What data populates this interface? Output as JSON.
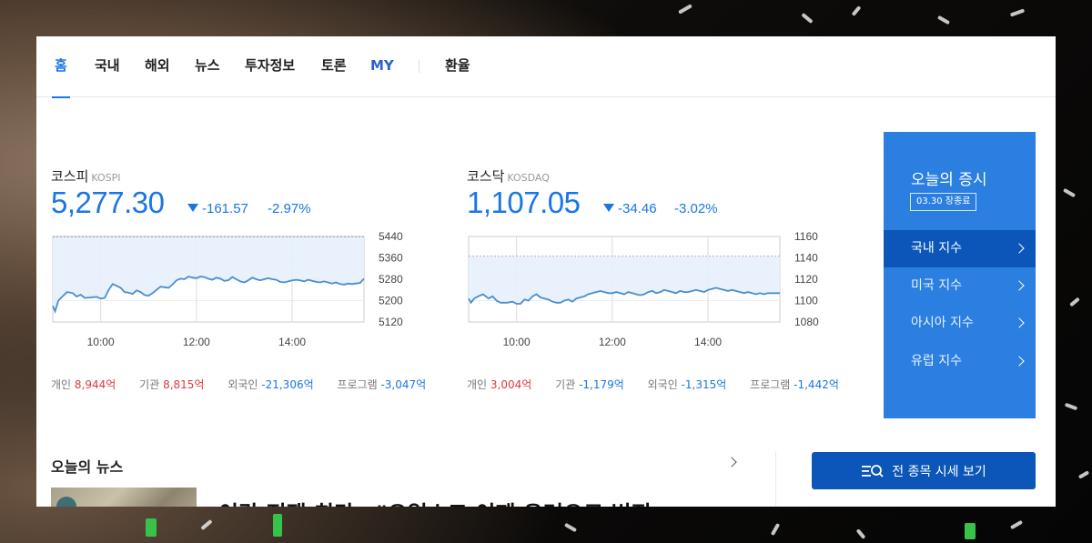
{
  "nav": {
    "items": [
      {
        "label": "홈",
        "active": true
      },
      {
        "label": "국내"
      },
      {
        "label": "해외"
      },
      {
        "label": "뉴스"
      },
      {
        "label": "투자정보"
      },
      {
        "label": "토론"
      },
      {
        "label": "MY"
      },
      {
        "label": "환율"
      }
    ]
  },
  "kospi": {
    "name": "코스피",
    "code": "KOSPI",
    "value": "5,277.30",
    "change": "-161.57",
    "percent": "-2.97%",
    "flows": [
      {
        "label": "개인",
        "value": "8,944억",
        "dir": "up"
      },
      {
        "label": "기관",
        "value": "8,815억",
        "dir": "up"
      },
      {
        "label": "외국인",
        "value": "-21,306억",
        "dir": "down"
      },
      {
        "label": "프로그램",
        "value": "-3,047억",
        "dir": "down"
      }
    ]
  },
  "kosdaq": {
    "name": "코스닥",
    "code": "KOSDAQ",
    "value": "1,107.05",
    "change": "-34.46",
    "percent": "-3.02%",
    "flows": [
      {
        "label": "개인",
        "value": "3,004억",
        "dir": "up"
      },
      {
        "label": "기관",
        "value": "-1,179억",
        "dir": "down"
      },
      {
        "label": "외국인",
        "value": "-1,315억",
        "dir": "down"
      },
      {
        "label": "프로그램",
        "value": "-1,442억",
        "dir": "down"
      }
    ]
  },
  "chart_data": [
    {
      "type": "area",
      "x_ticks": [
        "10:00",
        "12:00",
        "14:00"
      ],
      "y_ticks": [
        "5440",
        "5360",
        "5280",
        "5200",
        "5120"
      ],
      "ylim": [
        5120,
        5440
      ],
      "prev_close": 5438.87,
      "x_range": [
        "09:00",
        "15:30"
      ],
      "series": [
        {
          "x": [
            0,
            3,
            7,
            12,
            18,
            25,
            30,
            35,
            40,
            48,
            55,
            60,
            65,
            70,
            75,
            80,
            85,
            90,
            95,
            100,
            105,
            110,
            115,
            120,
            125,
            130,
            135,
            140,
            145,
            150,
            155,
            160,
            165,
            170,
            175,
            180,
            185,
            190,
            195,
            200,
            205,
            210,
            215,
            220,
            225,
            230,
            235,
            240,
            245,
            250,
            255,
            260,
            265,
            270,
            275,
            280,
            285,
            290,
            295,
            300,
            305,
            310,
            315,
            320,
            325,
            330,
            335,
            340,
            345,
            350,
            355,
            360,
            365,
            370,
            375,
            380,
            385,
            390
          ],
          "y": [
            5180,
            5160,
            5200,
            5215,
            5232,
            5228,
            5215,
            5222,
            5210,
            5212,
            5214,
            5208,
            5210,
            5240,
            5262,
            5255,
            5248,
            5232,
            5230,
            5225,
            5238,
            5232,
            5221,
            5218,
            5228,
            5240,
            5252,
            5250,
            5248,
            5260,
            5276,
            5282,
            5280,
            5290,
            5286,
            5284,
            5290,
            5288,
            5282,
            5278,
            5286,
            5282,
            5274,
            5276,
            5288,
            5280,
            5272,
            5268,
            5276,
            5286,
            5280,
            5276,
            5280,
            5284,
            5280,
            5278,
            5270,
            5268,
            5272,
            5276,
            5278,
            5276,
            5272,
            5278,
            5274,
            5270,
            5268,
            5272,
            5268,
            5264,
            5268,
            5262,
            5260,
            5264,
            5262,
            5264,
            5266,
            5282
          ]
        }
      ]
    },
    {
      "type": "area",
      "x_ticks": [
        "10:00",
        "12:00",
        "14:00"
      ],
      "y_ticks": [
        "1160",
        "1140",
        "1120",
        "1100",
        "1080"
      ],
      "ylim": [
        1080,
        1160
      ],
      "prev_close": 1141.51,
      "x_range": [
        "09:00",
        "15:30"
      ],
      "series": [
        {
          "x": [
            0,
            3,
            7,
            12,
            18,
            25,
            30,
            35,
            40,
            48,
            55,
            60,
            65,
            70,
            75,
            80,
            85,
            90,
            95,
            100,
            105,
            110,
            115,
            120,
            125,
            130,
            135,
            140,
            145,
            150,
            155,
            160,
            165,
            170,
            175,
            180,
            185,
            190,
            195,
            200,
            205,
            210,
            215,
            220,
            225,
            230,
            235,
            240,
            245,
            250,
            255,
            260,
            265,
            270,
            275,
            280,
            285,
            290,
            295,
            300,
            305,
            310,
            315,
            320,
            325,
            330,
            335,
            340,
            345,
            350,
            355,
            360,
            365,
            370,
            375,
            380,
            385,
            390
          ],
          "y": [
            1102,
            1098,
            1102,
            1104,
            1106,
            1102,
            1104,
            1100,
            1098,
            1098,
            1099,
            1097,
            1097,
            1101,
            1100,
            1104,
            1106,
            1103,
            1102,
            1101,
            1099,
            1098,
            1098,
            1100,
            1101,
            1099,
            1102,
            1103,
            1104,
            1106,
            1107,
            1108,
            1109,
            1108,
            1107,
            1107,
            1108,
            1107,
            1106,
            1108,
            1107,
            1106,
            1105,
            1106,
            1108,
            1109,
            1107,
            1108,
            1110,
            1109,
            1108,
            1107,
            1109,
            1108,
            1108,
            1109,
            1110,
            1109,
            1108,
            1110,
            1111,
            1112,
            1111,
            1110,
            1109,
            1110,
            1109,
            1108,
            1107,
            1108,
            1107,
            1106,
            1107,
            1106,
            1107,
            1107,
            1107,
            1107
          ]
        }
      ]
    }
  ],
  "side": {
    "title": "오늘의 증시",
    "date": "03.30 장종료",
    "items": [
      {
        "label": "국내 지수",
        "active": true
      },
      {
        "label": "미국 지수"
      },
      {
        "label": "아시아 지수"
      },
      {
        "label": "유럽 지수"
      }
    ]
  },
  "news": {
    "title": "오늘의 뉴스",
    "headline": "이란 전쟁 최단…\"오일쇼크 이제 우려으로 번진"
  },
  "all_button": {
    "label": "전 종목 시세 보기"
  },
  "colors": {
    "accent": "#1a76e3",
    "side_bg": "#2a7fe0",
    "side_active": "#0b56b8",
    "up": "#e0383e",
    "down": "#1a76e3"
  }
}
